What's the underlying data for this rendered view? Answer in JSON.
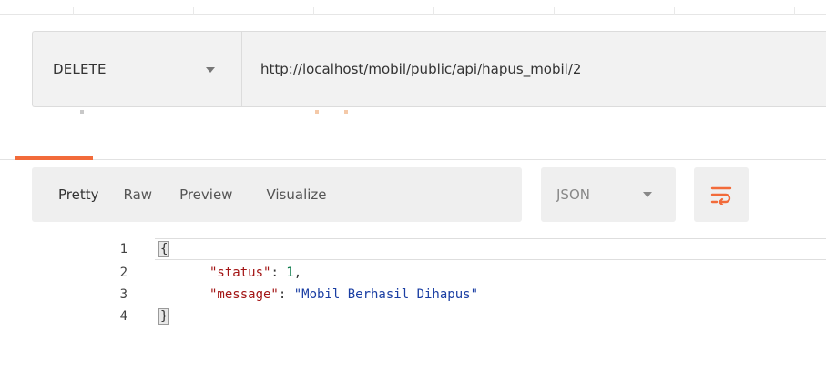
{
  "request": {
    "method": "DELETE",
    "url": "http://localhost/mobil/public/api/hapus_mobil/2"
  },
  "response_tabs": [
    {
      "label": "Pretty"
    },
    {
      "label": "Raw"
    },
    {
      "label": "Preview"
    },
    {
      "label": "Visualize"
    }
  ],
  "format": {
    "selected": "JSON"
  },
  "colors": {
    "accent": "#f26b3a",
    "json_key": "#a31515",
    "json_string": "#1a3ea3",
    "json_number": "#0b7a4a"
  },
  "code": {
    "line_numbers": [
      "1",
      "2",
      "3",
      "4"
    ],
    "open_brace": "{",
    "close_brace": "}",
    "entries": [
      {
        "key": "\"status\"",
        "colon": ": ",
        "value": "1",
        "trail": ","
      },
      {
        "key": "\"message\"",
        "colon": ": ",
        "value": "\"Mobil Berhasil Dihapus\"",
        "trail": ""
      }
    ]
  },
  "icons": {
    "method_dropdown": "chevron-down-icon",
    "format_dropdown": "chevron-down-icon",
    "wrap": "wrap-lines-icon"
  }
}
